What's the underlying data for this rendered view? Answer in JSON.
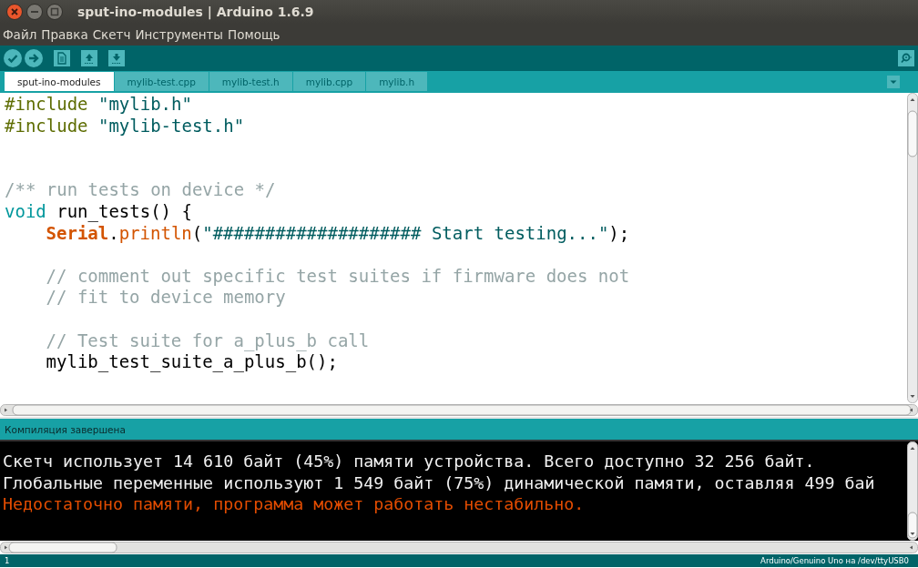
{
  "window": {
    "title": "sput-ino-modules | Arduino 1.6.9"
  },
  "menu": [
    "Файл",
    "Правка",
    "Скетч",
    "Инструменты",
    "Помощь"
  ],
  "tabs": [
    {
      "label": "sput-ino-modules",
      "selected": true
    },
    {
      "label": "mylib-test.cpp",
      "selected": false
    },
    {
      "label": "mylib-test.h",
      "selected": false
    },
    {
      "label": "mylib.cpp",
      "selected": false
    },
    {
      "label": "mylib.h",
      "selected": false
    }
  ],
  "code_lines": [
    {
      "kind": "code",
      "indented": false,
      "segments": [
        {
          "kind": "preprocessor",
          "text": "#include"
        },
        {
          "kind": "string",
          "text": "\"mylib.h\""
        }
      ]
    },
    {
      "kind": "code",
      "indented": false,
      "segments": [
        {
          "kind": "preprocessor",
          "text": "#include"
        },
        {
          "kind": "string",
          "text": "\"mylib-test.h\""
        }
      ]
    },
    {
      "kind": "blank"
    },
    {
      "kind": "blank"
    },
    {
      "kind": "code",
      "indented": false,
      "segments": [
        {
          "kind": "comment",
          "text": "/** run tests on device */"
        }
      ]
    },
    {
      "kind": "code",
      "indented": false,
      "segments": [
        {
          "kind": "keyword",
          "text": "void"
        },
        {
          "kind": "plain",
          "text": " run_tests() {"
        }
      ]
    },
    {
      "kind": "code",
      "indented": true,
      "segments": [
        {
          "kind": "class",
          "text": "Serial"
        },
        {
          "kind": "plain",
          "text": "."
        },
        {
          "kind": "function",
          "text": "println"
        },
        {
          "kind": "plain",
          "text": "("
        },
        {
          "kind": "string",
          "text": "\"#################### Start testing...\""
        },
        {
          "kind": "plain",
          "text": ");"
        }
      ]
    },
    {
      "kind": "blank"
    },
    {
      "kind": "code",
      "indented": true,
      "segments": [
        {
          "kind": "comment",
          "text": "// comment out specific test suites if firmware does not"
        }
      ]
    },
    {
      "kind": "code",
      "indented": true,
      "segments": [
        {
          "kind": "comment",
          "text": "// fit to device memory"
        }
      ]
    },
    {
      "kind": "blank"
    },
    {
      "kind": "code",
      "indented": true,
      "segments": [
        {
          "kind": "comment",
          "text": "// Test suite for a_plus_b call"
        }
      ]
    },
    {
      "kind": "code",
      "indented": true,
      "segments": [
        {
          "kind": "plain",
          "text": "mylib_test_suite_a_plus_b();"
        }
      ]
    }
  ],
  "status": "Компиляция завершена",
  "console": [
    {
      "kind": "info",
      "text": "Скетч использует 14 610 байт (45%) памяти устройства. Всего доступно 32 256 байт."
    },
    {
      "kind": "info",
      "text": "Глобальные переменные используют 1 549 байт (75%) динамической памяти, оставляя 499 бай"
    },
    {
      "kind": "warning",
      "text": "Недостаточно памяти, программа может работать нестабильно."
    }
  ],
  "footer": {
    "line": "1",
    "board": "Arduino/Genuino Uno на /dev/ttyUSB0"
  }
}
